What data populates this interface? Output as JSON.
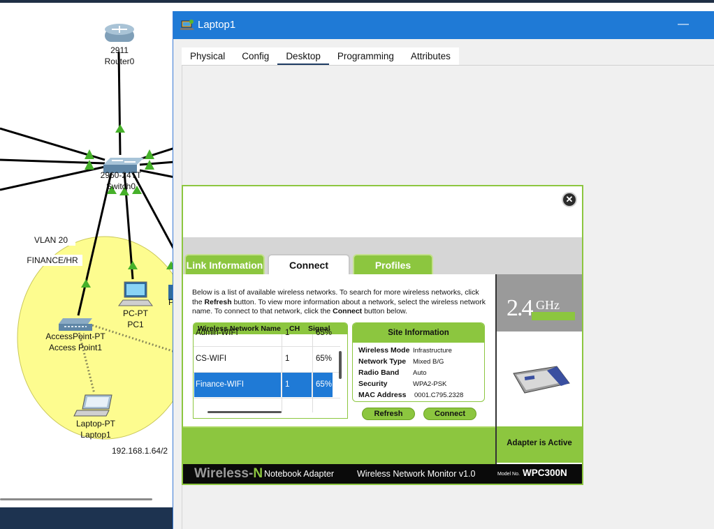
{
  "topology": {
    "router": {
      "model": "2911",
      "name": "Router0"
    },
    "switch": {
      "model": "2960-24TT",
      "name": "Switch0"
    },
    "vlan_label": "VLAN 20",
    "dept_label": "FINANCE/HR",
    "pc": {
      "model": "PC-PT",
      "name": "PC1"
    },
    "pc_partial": "P",
    "access_point": {
      "model": "AccessPoint-PT",
      "name": "Access Point1"
    },
    "laptop": {
      "model": "Laptop-PT",
      "name": "Laptop1"
    },
    "subnet": "192.168.1.64/2"
  },
  "window": {
    "title": "Laptop1",
    "minimize_symbol": "—",
    "tabs": [
      "Physical",
      "Config",
      "Desktop",
      "Programming",
      "Attributes"
    ],
    "active_tab": "Desktop"
  },
  "app": {
    "close_symbol": "✕",
    "tabs": [
      "Link Information",
      "Connect",
      "Profiles"
    ],
    "active_tab": "Connect",
    "description": {
      "p1": "Below is a list of available wireless networks. To search for more wireless networks, click the ",
      "b1": "Refresh",
      "p2": " button. To view more information about a network, select the wireless network name. To connect to that network, click the ",
      "b2": "Connect",
      "p3": " button below."
    },
    "network_table": {
      "headers": [
        "Wireless Network Name",
        "CH",
        "Signal"
      ],
      "rows": [
        {
          "name": "Admin-WIFI",
          "ch": "1",
          "signal": "65%"
        },
        {
          "name": "CS-WIFI",
          "ch": "1",
          "signal": "65%"
        },
        {
          "name": "Finance-WIFI",
          "ch": "1",
          "signal": "65%"
        }
      ],
      "selected_index": 2
    },
    "site_info": {
      "title": "Site Information",
      "rows": [
        {
          "key": "Wireless Mode",
          "value": "Infrastructure"
        },
        {
          "key": "Network Type",
          "value": "Mixed B/G"
        },
        {
          "key": "Radio Band",
          "value": "Auto"
        },
        {
          "key": "Security",
          "value": "WPA2-PSK"
        },
        {
          "key": "MAC Address",
          "value": "0001.C795.2328"
        }
      ]
    },
    "buttons": {
      "refresh": "Refresh",
      "connect": "Connect"
    },
    "band": {
      "number": "2.4",
      "unit": "GHz"
    },
    "adapter_status": "Adapter is Active",
    "footer": {
      "logo_main": "Wireless-",
      "logo_n": "N",
      "adapter_type": "Notebook Adapter",
      "monitor_name": "Wireless Network Monitor  v1.0",
      "model_label": "Model No.",
      "model_value": "WPC300N"
    }
  },
  "colors": {
    "accent_green": "#8cc63f",
    "window_blue": "#1f7ad6",
    "selection_blue": "#1f7ad6",
    "coverage_yellow": "#fdfc8f"
  }
}
